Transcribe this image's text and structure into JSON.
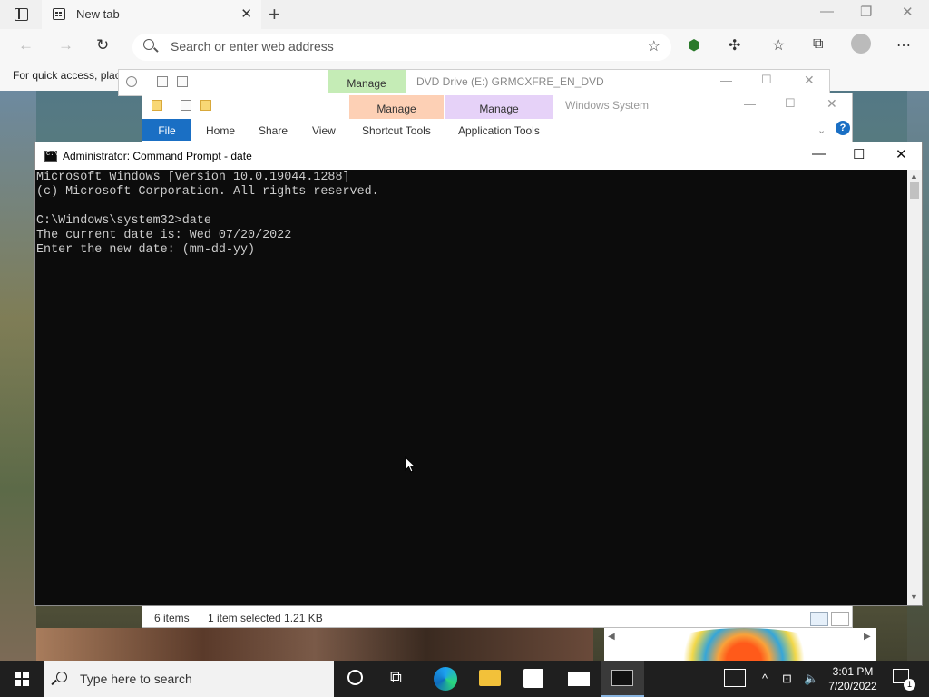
{
  "browser": {
    "tab_label": "New tab",
    "address_placeholder": "Search or enter web address",
    "quick_access_text": "For quick access, plac"
  },
  "explorer_back": {
    "manage_label": "Manage",
    "title": "DVD Drive (E:) GRMCXFRE_EN_DVD"
  },
  "explorer_front": {
    "manage1_label": "Manage",
    "manage2_label": "Manage",
    "title": "Windows System",
    "ribbon": {
      "file": "File",
      "home": "Home",
      "share": "Share",
      "view": "View",
      "shortcut_tools": "Shortcut Tools",
      "application_tools": "Application Tools"
    },
    "status": {
      "items": "6 items",
      "selected": "1 item selected  1.21 KB"
    },
    "colors": {
      "manage1": "#fdd0b5",
      "manage2": "#e6d2f8",
      "file_tab": "#1a6fc4"
    }
  },
  "cmd": {
    "title": "Administrator: Command Prompt - date",
    "lines": [
      "Microsoft Windows [Version 10.0.19044.1288]",
      "(c) Microsoft Corporation. All rights reserved.",
      "",
      "C:\\Windows\\system32>date",
      "The current date is: Wed 07/20/2022",
      "Enter the new date: (mm-dd-yy)"
    ]
  },
  "taskbar": {
    "search_placeholder": "Type here to search",
    "time": "3:01 PM",
    "date": "7/20/2022",
    "notification_count": "1"
  }
}
